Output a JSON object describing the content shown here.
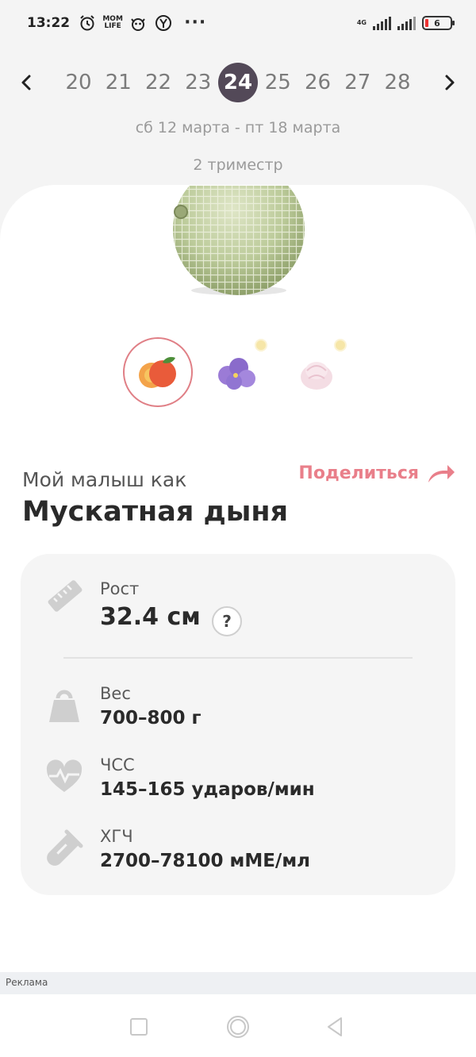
{
  "status_bar": {
    "time": "13:22",
    "notif_icons": [
      "alarm-icon",
      "mom-life-icon",
      "cat-sticker-icon",
      "yandex-icon"
    ],
    "mom_life_text": "MOM LIFE",
    "more": "···",
    "network": "4G",
    "battery": "6"
  },
  "weeks": {
    "items": [
      "20",
      "21",
      "22",
      "23",
      "24",
      "25",
      "26",
      "27",
      "28"
    ],
    "active": "24",
    "date_range": "сб 12 марта - пт 18 марта",
    "trimester": "2 триместр"
  },
  "fruit": {
    "subtitle": "Мой малыш как",
    "name": "Мускатная дыня",
    "share_label": "Поделиться",
    "variants": [
      {
        "name": "peach",
        "selected": true,
        "premium": false
      },
      {
        "name": "violet-flower",
        "selected": false,
        "premium": true
      },
      {
        "name": "marshmallow",
        "selected": false,
        "premium": true
      }
    ]
  },
  "stats": {
    "height": {
      "label": "Рост",
      "value": "32.4 см",
      "help": "?"
    },
    "weight": {
      "label": "Вес",
      "value": "700–800 г"
    },
    "heart_rate": {
      "label": "ЧСС",
      "value": "145–165 ударов/мин"
    },
    "hcg": {
      "label": "ХГЧ",
      "value": "2700–78100 мМЕ/мл"
    }
  },
  "ad_label": "Реклама",
  "colors": {
    "active_week": "#534958",
    "accent": "#e97f8a",
    "panel_bg": "#f5f5f5",
    "icon_gray": "#cfcfcf"
  }
}
